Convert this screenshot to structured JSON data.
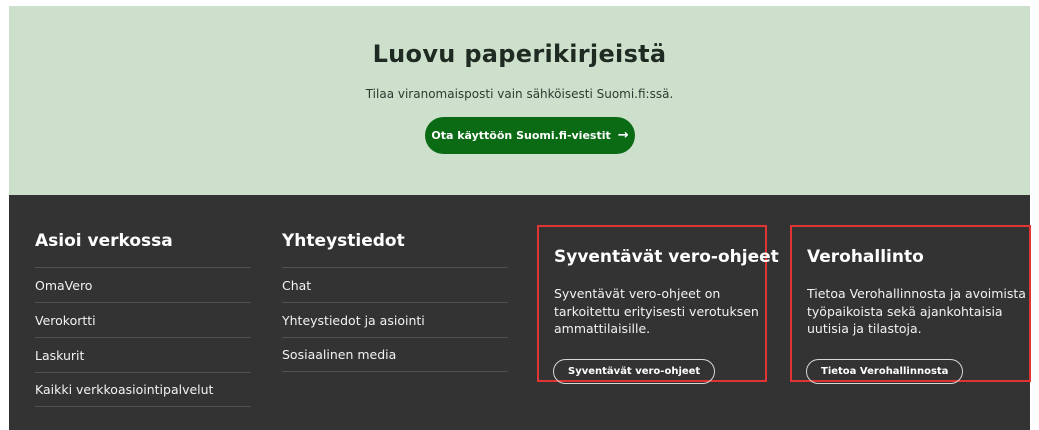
{
  "promo": {
    "title": "Luovu paperikirjeistä",
    "subtitle": "Tilaa viranomaisposti vain sähköisesti Suomi.fi:ssä.",
    "button_label": "Ota käyttöön Suomi.fi-viestit",
    "button_icon": "→",
    "background": "#cce0cc",
    "button_color": "#0a6b14"
  },
  "footer": {
    "background": "#333333",
    "asioi": {
      "title": "Asioi verkossa",
      "links": [
        "OmaVero",
        "Verokortti",
        "Laskurit",
        "Kaikki verkkoasiointipalvelut"
      ]
    },
    "yhteystiedot": {
      "title": "Yhteystiedot",
      "links": [
        "Chat",
        "Yhteystiedot ja asiointi",
        "Sosiaalinen media"
      ]
    },
    "syventavat": {
      "title": "Syventävät vero-ohjeet",
      "text_lines": [
        "Syventävät vero-ohjeet on",
        "tarkoitettu erityisesti verotuksen",
        "ammattilaisille."
      ],
      "button_label": "Syventävät vero-ohjeet"
    },
    "verohallinto": {
      "title": "Verohallinto",
      "text_lines": [
        "Tietoa Verohallinnosta ja avoimista",
        "työpaikoista sekä ajankohtaisia",
        "uutisia ja tilastoja."
      ],
      "button_label": "Tietoa Verohallinnosta"
    },
    "highlight_color": "#e03434"
  }
}
